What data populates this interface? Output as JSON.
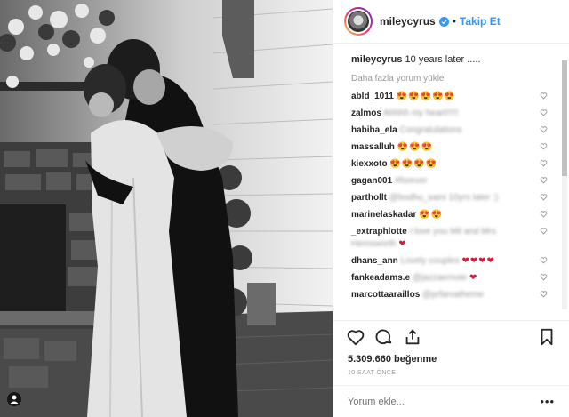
{
  "header": {
    "username": "mileycyrus",
    "separator": "•",
    "follow_label": "Takip Et"
  },
  "caption": {
    "username": "mileycyrus",
    "text": "10 years later ....."
  },
  "load_more_label": "Daha fazla yorum yükle",
  "comments": [
    {
      "user": "abld_1011",
      "text": "",
      "emoji": "😍😍😍😍😍"
    },
    {
      "user": "zalmos",
      "text": "Ahhhh my heart!!!!!",
      "emoji": ""
    },
    {
      "user": "habiba_ela",
      "text": "Congratulations",
      "emoji": ""
    },
    {
      "user": "massalluh",
      "text": "",
      "emoji": "😍😍😍"
    },
    {
      "user": "kiexxoto",
      "text": "",
      "emoji": "😍😍😍😍"
    },
    {
      "user": "gagan001",
      "text": "#forever",
      "emoji": ""
    },
    {
      "user": "parthollt",
      "text": "@bodhu_saini 10yrs later :)",
      "emoji": ""
    },
    {
      "user": "marinelaskadar",
      "text": "",
      "emoji": "😍😍"
    },
    {
      "user": "_extraphlotte",
      "text": "I love you Mil and Mrs Hemsworth",
      "emoji": "❤"
    },
    {
      "user": "dhans_ann",
      "text": "Lovely couples",
      "emoji": "❤❤❤❤"
    },
    {
      "user": "fankeadams.e",
      "text": "@jazzaemote",
      "emoji": "❤"
    },
    {
      "user": "marcottaaraillos",
      "text": "@prfarvatheme",
      "emoji": ""
    }
  ],
  "likes": "5.309.660 beğenme",
  "timestamp": "10 SAAT ÖNCE",
  "comment_input": {
    "placeholder": "Yorum ekle..."
  },
  "options_label": "•••",
  "icons": {
    "verified": "verified-badge-icon",
    "like": "heart-outline-icon",
    "comment": "comment-bubble-icon",
    "share": "share-upload-icon",
    "save": "bookmark-icon",
    "user_tag": "user-tag-icon"
  },
  "colors": {
    "follow": "#3897f0",
    "text": "#262626",
    "muted": "#999999",
    "border": "#efefef"
  }
}
